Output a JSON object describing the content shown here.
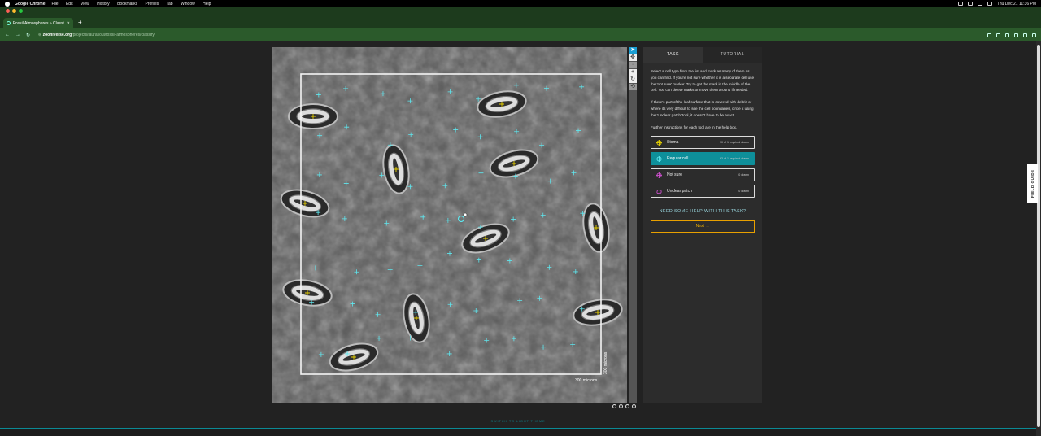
{
  "menubar": {
    "app": "Google Chrome",
    "items": [
      "File",
      "Edit",
      "View",
      "History",
      "Bookmarks",
      "Profiles",
      "Tab",
      "Window",
      "Help"
    ],
    "clock": "Thu Dec 21  11:36 PM"
  },
  "browser": {
    "tab_title": "Fossil Atmospheres » Classify",
    "url_host": "zooniverse.org",
    "url_path": "/projects/laurasoul/fossil-atmospheres/classify"
  },
  "subject": {
    "scale_h": "300 microns",
    "scale_v": "300 microns"
  },
  "panel": {
    "tabs": [
      "TASK",
      "TUTORIAL"
    ],
    "instructions": [
      "Select a cell type from the list and mark as many of them as you can find. If you're not sure whether it is a separate cell use the 'not sure' marker. Try to get the mark in the middle of the cell. You can delete marks or move them around if needed.",
      "If there's part of the leaf surface that is covered with debris or where its very difficult to see the cell boundaries, circle it using the 'Unclear patch' tool, it doesn't have to be exact.",
      "Further instructions for each tool are in the help box."
    ],
    "tools": [
      {
        "label": "Stoma",
        "count": "10 of 1 required drawn",
        "color": "#e8d200"
      },
      {
        "label": "Regular cell",
        "count": "63 of 1 required drawn",
        "color": "#5fe6ee"
      },
      {
        "label": "Not sure",
        "count": "0 drawn",
        "color": "#d050d0"
      },
      {
        "label": "Unclear patch",
        "count": "0 drawn",
        "color": "#d050d0"
      }
    ],
    "help": "NEED SOME HELP WITH THIS TASK?",
    "next": "Next →"
  },
  "field_guide": "FIELD GUIDE",
  "theme_switch": "SWITCH TO LIGHT THEME"
}
